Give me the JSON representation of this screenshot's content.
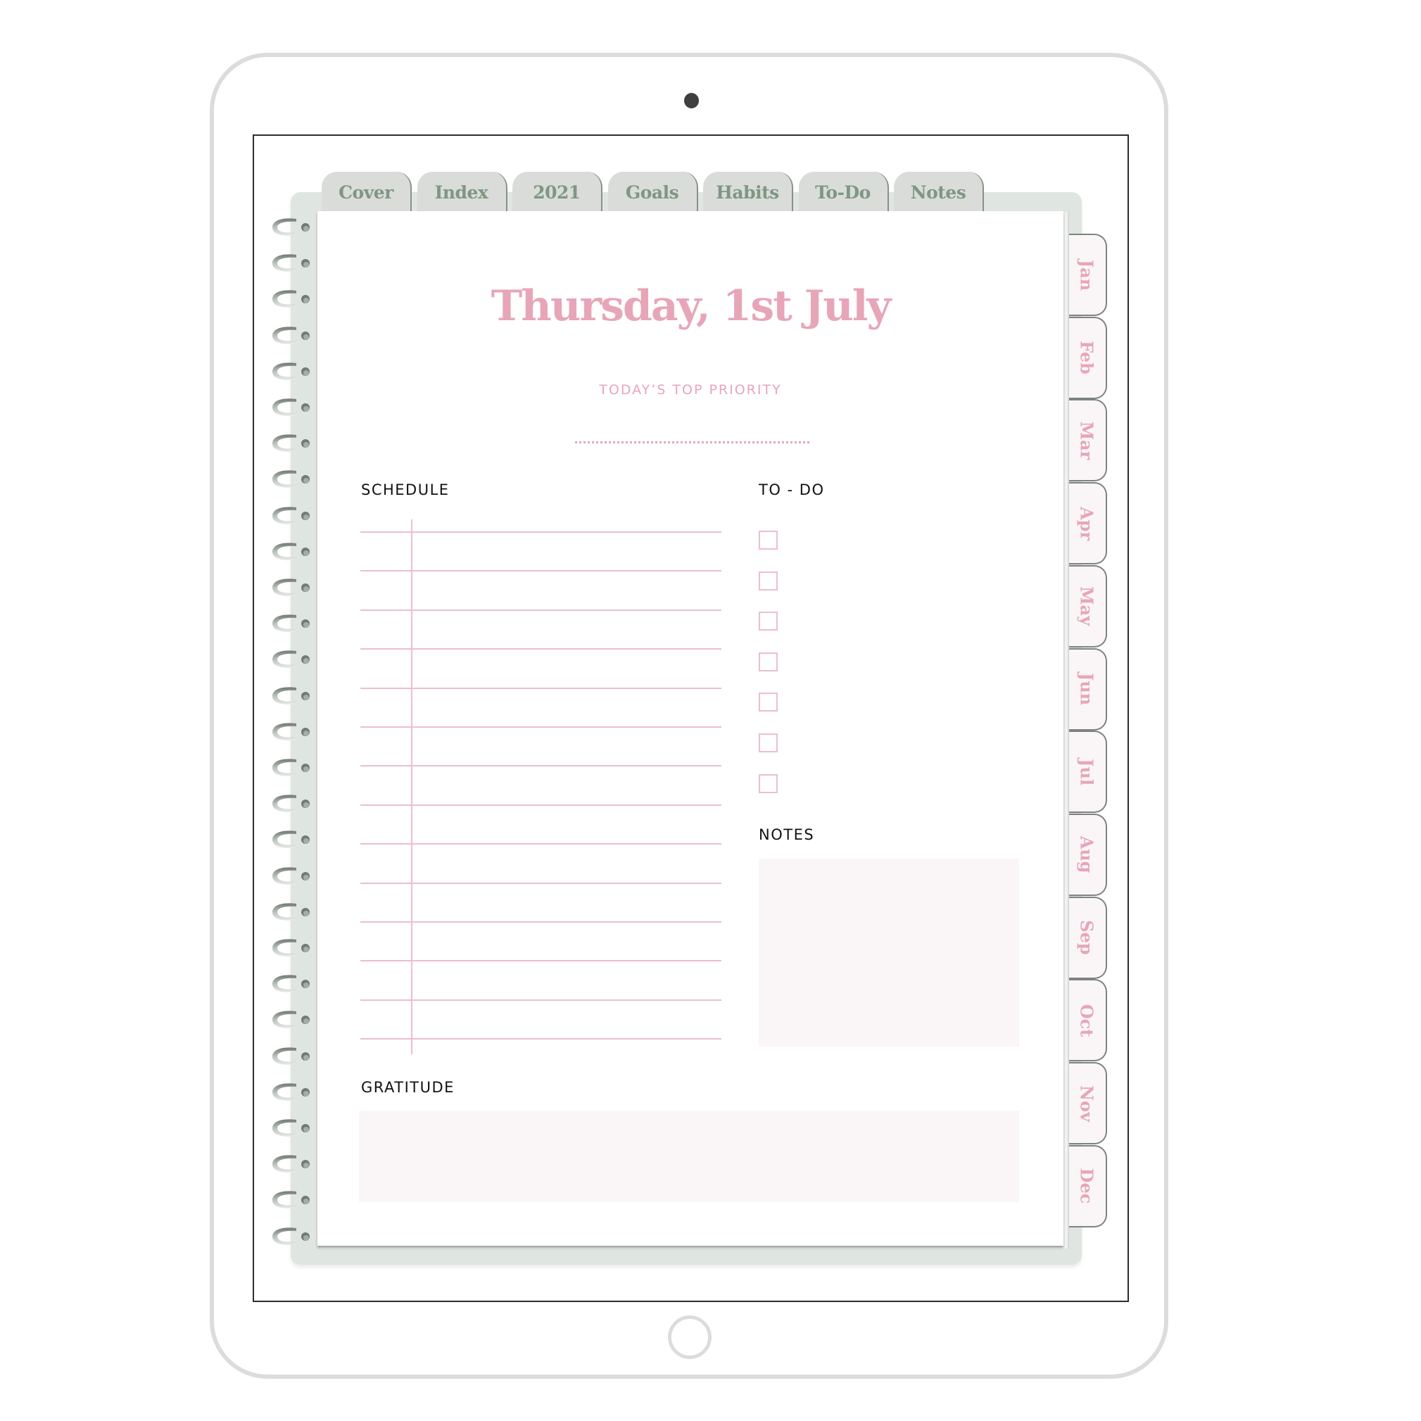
{
  "device": {
    "type": "tablet"
  },
  "top_tabs": [
    {
      "label": "Cover"
    },
    {
      "label": "Index"
    },
    {
      "label": "2021"
    },
    {
      "label": "Goals"
    },
    {
      "label": "Habits"
    },
    {
      "label": "To-Do"
    },
    {
      "label": "Notes"
    }
  ],
  "month_tabs": [
    {
      "label": "Jan"
    },
    {
      "label": "Feb"
    },
    {
      "label": "Mar"
    },
    {
      "label": "Apr"
    },
    {
      "label": "May"
    },
    {
      "label": "Jun"
    },
    {
      "label": "Jul"
    },
    {
      "label": "Aug"
    },
    {
      "label": "Sep"
    },
    {
      "label": "Oct"
    },
    {
      "label": "Nov"
    },
    {
      "label": "Dec"
    }
  ],
  "page": {
    "title": "Thursday, 1st July",
    "priority_label": "TODAY’S TOP PRIORITY",
    "priority_value": "",
    "schedule": {
      "label": "SCHEDULE",
      "row_count": 14,
      "entries": []
    },
    "todo": {
      "label": "TO - DO",
      "items": [
        {
          "text": "",
          "checked": false
        },
        {
          "text": "",
          "checked": false
        },
        {
          "text": "",
          "checked": false
        },
        {
          "text": "",
          "checked": false
        },
        {
          "text": "",
          "checked": false
        },
        {
          "text": "",
          "checked": false
        },
        {
          "text": "",
          "checked": false
        }
      ]
    },
    "notes": {
      "label": "NOTES",
      "value": ""
    },
    "gratitude": {
      "label": "GRATITUDE",
      "value": ""
    }
  },
  "colors": {
    "accent_pink": "#e7a6b8",
    "tab_green_text": "#7f9683",
    "tab_bg": "#d9dcd8",
    "binder_bg": "#dfe5e1",
    "box_fill": "#faf6f7"
  }
}
